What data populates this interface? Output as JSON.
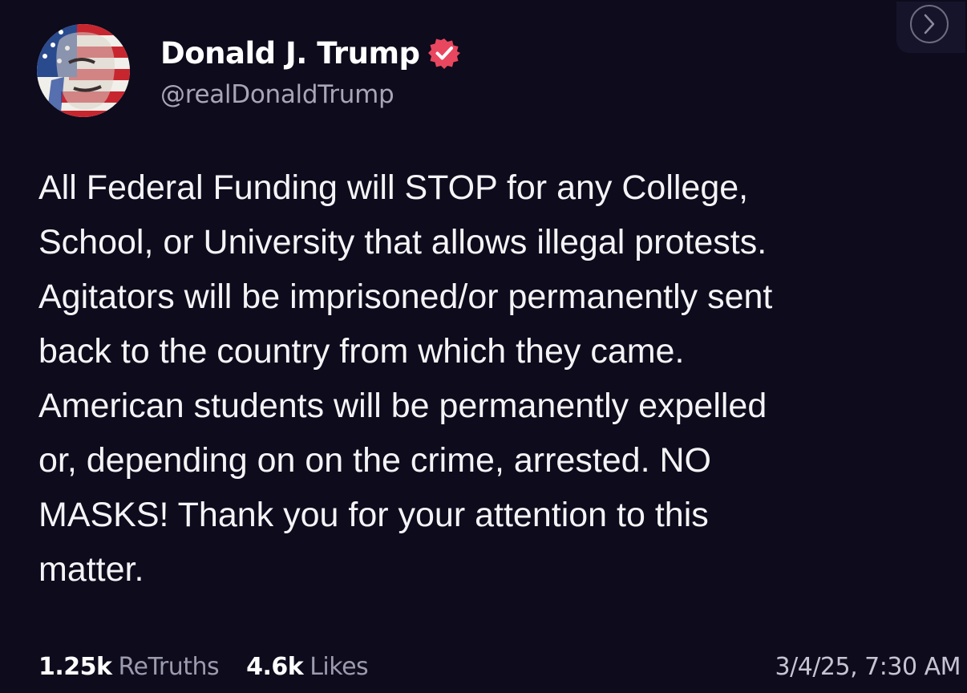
{
  "author": {
    "display_name": "Donald J. Trump",
    "handle": "@realDonaldTrump",
    "verified": true,
    "verified_color": "#e8475f"
  },
  "post": {
    "lines": [
      "All Federal Funding will STOP for any College,",
      "School, or University that allows illegal protests.",
      "Agitators will be imprisoned/or permanently sent",
      "back to the country from which they came.",
      "American students will be permanently expelled",
      "or, depending on on the crime, arrested. NO",
      "MASKS! Thank you for your attention to this",
      "matter."
    ]
  },
  "stats": {
    "retruths_count": "1.25k",
    "retruths_label": "ReTruths",
    "likes_count": "4.6k",
    "likes_label": "Likes"
  },
  "timestamp": "3/4/25, 7:30 AM",
  "icons": {
    "verified": "verified-badge-icon",
    "next": "chevron-right-icon"
  }
}
